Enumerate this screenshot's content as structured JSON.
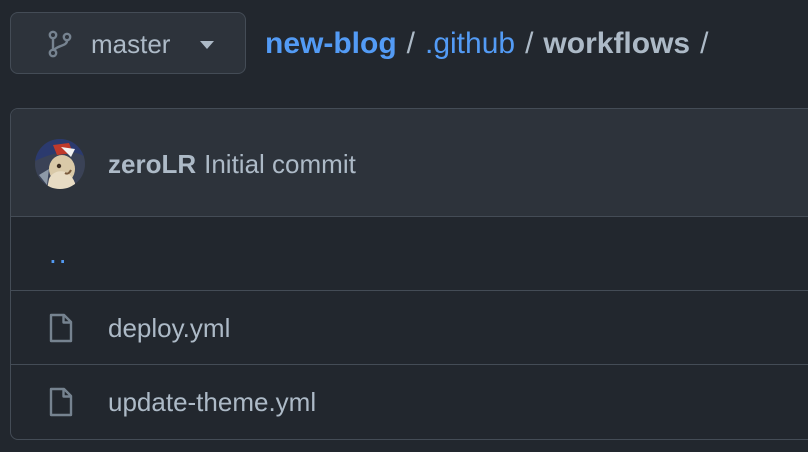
{
  "branch": {
    "icon": "git-branch-icon",
    "label": "master",
    "caret_icon": "caret-down-icon"
  },
  "breadcrumb": {
    "repo": "new-blog",
    "separator": "/",
    "segment": ".github",
    "current": "workflows",
    "trailing_separator": "/"
  },
  "latest_commit": {
    "avatar_icon": "user-avatar",
    "author": "zeroLR",
    "message": "Initial commit"
  },
  "file_list": {
    "parent_dir_link": "..",
    "files": [
      {
        "name": "deploy.yml",
        "icon": "file-icon"
      },
      {
        "name": "update-theme.yml",
        "icon": "file-icon"
      }
    ]
  },
  "colors": {
    "background": "#22272e",
    "panel": "#2d333b",
    "border": "#444c56",
    "link": "#539bf5",
    "text": "#adbac7",
    "icon": "#768390"
  }
}
